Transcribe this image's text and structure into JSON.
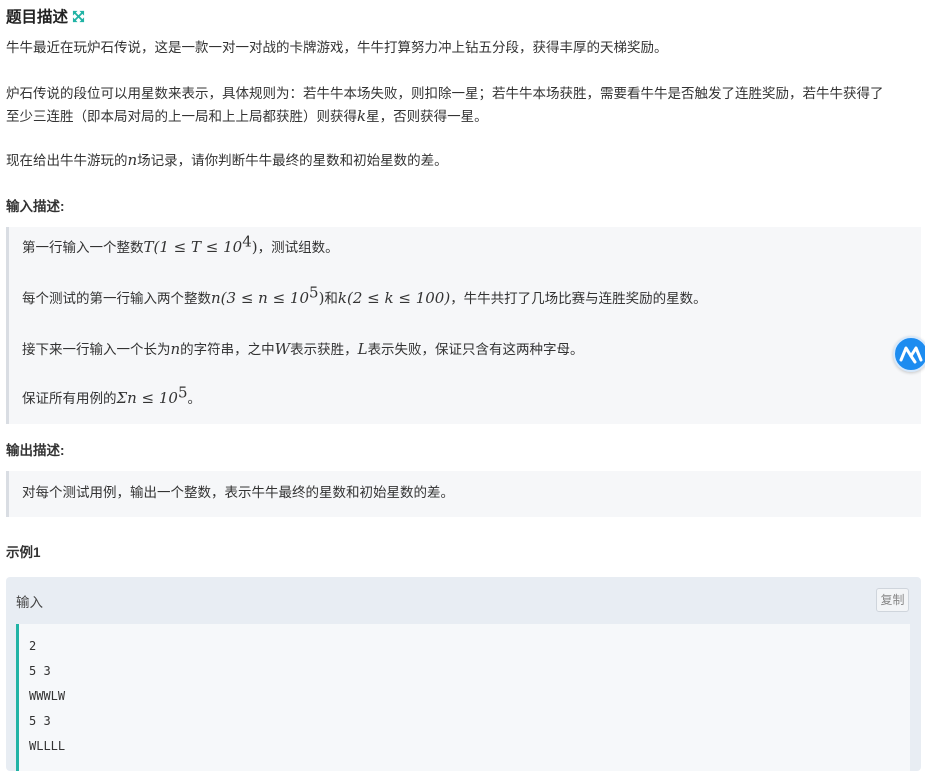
{
  "header": {
    "title": "题目描述",
    "icon": "expand-arrows-icon",
    "icon_color": "#21b3a5"
  },
  "description": {
    "p1": "牛牛最近在玩炉石传说，这是一款一对一对战的卡牌游戏，牛牛打算努力冲上钻五分段，获得丰厚的天梯奖励。",
    "p2_line1": "炉石传说的段位可以用星数来表示，具体规则为：若牛牛本场失败，则扣除一星；若牛牛本场获胜，需要看牛牛是否触发了连胜奖励，若牛牛获得了",
    "p2_line2_a": "至少三连胜（即本局对局的上一局和上上局都获胜）则获得",
    "p2_line2_k": "k",
    "p2_line2_b": "星，否则获得一星。",
    "p3_a": "现在给出牛牛游玩的",
    "p3_n": "n",
    "p3_b": "场记录，请你判断牛牛最终的星数和初始星数的差。"
  },
  "input_section": {
    "heading": "输入描述:",
    "l1_a": "第一行输入一个整数",
    "l1_math": "T(1 ≤ T ≤ 10",
    "l1_sup": "4",
    "l1_close": ")",
    "l1_b": "，测试组数。",
    "l2_a": "每个测试的第一行输入两个整数",
    "l2_math1": "n(3 ≤ n ≤ 10",
    "l2_sup1": "5",
    "l2_close1": ")",
    "l2_mid": "和",
    "l2_math2": "k(2 ≤ k ≤ 100)",
    "l2_b": "，牛牛共打了几场比赛与连胜奖励的星数。",
    "l3_a": "接下来一行输入一个长为",
    "l3_n": "n",
    "l3_b": "的字符串，之中",
    "l3_W": "W",
    "l3_c": "表示获胜，",
    "l3_L": "L",
    "l3_d": "表示失败，保证只含有这两种字母。",
    "l4_a": "保证所有用例的",
    "l4_math": "Σn ≤ 10",
    "l4_sup": "5",
    "l4_b": "。"
  },
  "output_section": {
    "heading": "输出描述:",
    "text": "对每个测试用例，输出一个整数，表示牛牛最终的星数和初始星数的差。"
  },
  "example": {
    "heading": "示例1",
    "input_label": "输入",
    "copy_label": "复制",
    "lines": [
      "2",
      "5 3",
      "WWWLW",
      "5 3",
      "WLLLL"
    ]
  },
  "floating": {
    "icon": "assistant-logo-icon",
    "color": "#1d8cf0"
  }
}
